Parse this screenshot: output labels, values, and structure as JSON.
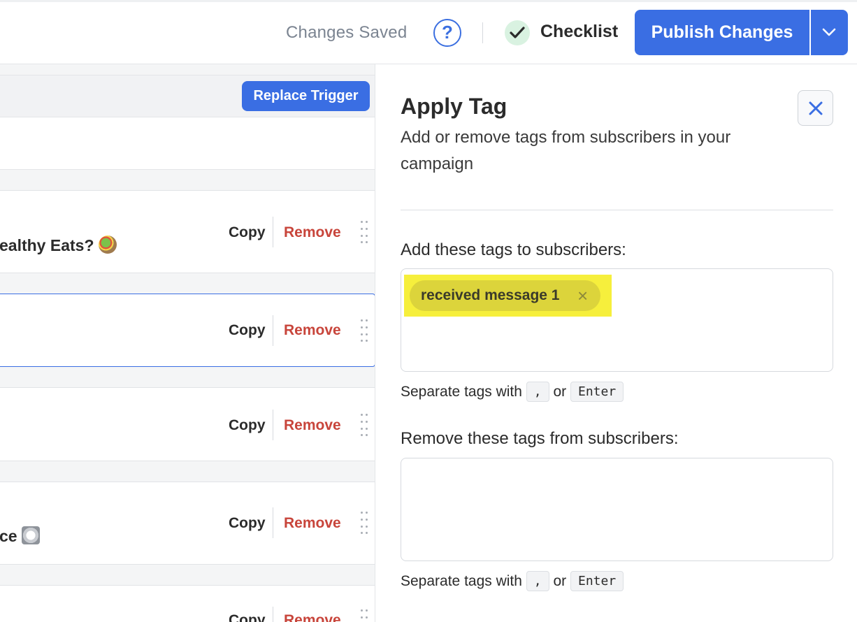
{
  "header": {
    "saved_status": "Changes Saved",
    "help_glyph": "?",
    "checklist_label": "Checklist",
    "publish_label": "Publish Changes"
  },
  "canvas": {
    "replace_trigger_label": "Replace Trigger",
    "cards": [
      {
        "snippet": "ealthy Eats?",
        "emoji": "salad",
        "copy": "Copy",
        "remove": "Remove"
      },
      {
        "snippet": "",
        "copy": "Copy",
        "remove": "Remove",
        "selected": true
      },
      {
        "snippet": "",
        "copy": "Copy",
        "remove": "Remove"
      },
      {
        "snippet": "ce",
        "emoji": "plate",
        "copy": "Copy",
        "remove": "Remove"
      },
      {
        "snippet": "",
        "copy": "Copy",
        "remove": "Remove"
      }
    ]
  },
  "panel": {
    "title": "Apply Tag",
    "description": "Add or remove tags from subscribers in your campaign",
    "add_label": "Add these tags to subscribers:",
    "add_tags": [
      "received message 1"
    ],
    "remove_label": "Remove these tags from subscribers:",
    "remove_tags": [],
    "hint_prefix": "Separate tags with",
    "hint_key_comma": ",",
    "hint_or": "or",
    "hint_key_enter": "Enter"
  },
  "colors": {
    "accent": "#3a6ee3",
    "remove": "#c8453b",
    "tag_highlight": "#f6ef3c",
    "tag_chip": "#dcd43b"
  }
}
